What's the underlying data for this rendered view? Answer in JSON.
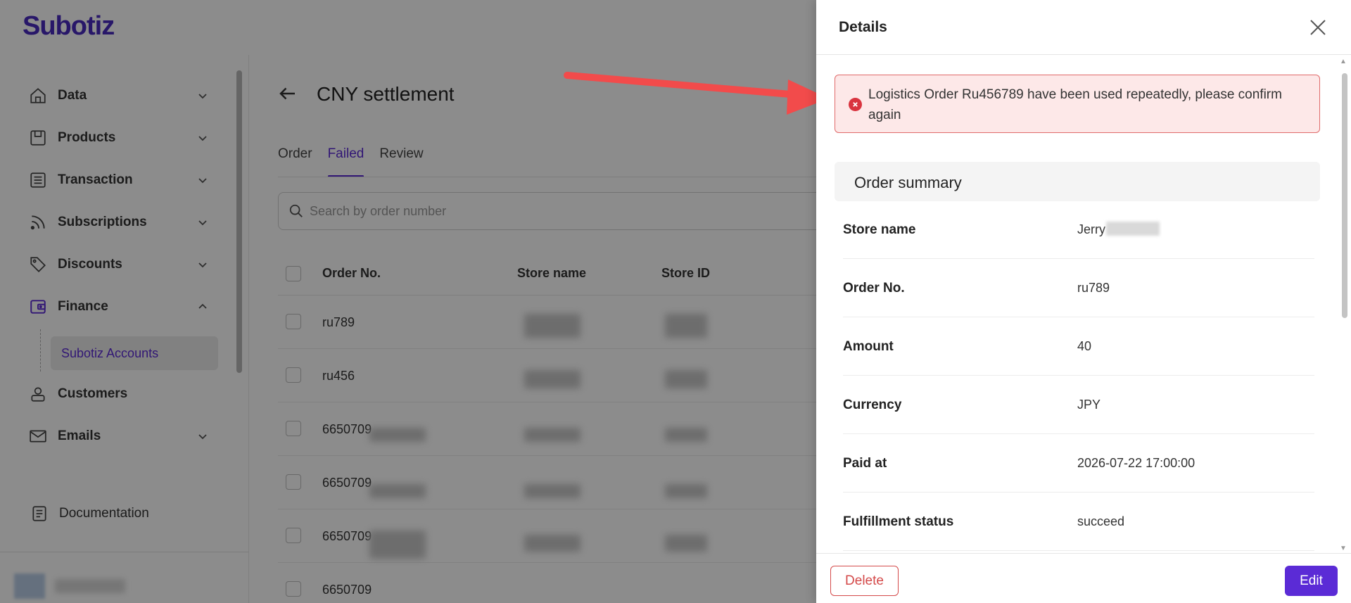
{
  "app": {
    "logo": "Subotiz",
    "accent_color": "#5b2bd6"
  },
  "sidebar": {
    "items": [
      {
        "label": "Data",
        "icon": "home-icon",
        "expandable": true
      },
      {
        "label": "Products",
        "icon": "box-icon",
        "expandable": true
      },
      {
        "label": "Transaction",
        "icon": "list-icon",
        "expandable": true
      },
      {
        "label": "Subscriptions",
        "icon": "rss-icon",
        "expandable": true
      },
      {
        "label": "Discounts",
        "icon": "tag-icon",
        "expandable": true
      },
      {
        "label": "Finance",
        "icon": "wallet-icon",
        "expandable": true,
        "expanded": true
      },
      {
        "label": "Customers",
        "icon": "user-icon",
        "expandable": false
      },
      {
        "label": "Emails",
        "icon": "mail-icon",
        "expandable": true
      }
    ],
    "sub_item": "Subotiz Accounts",
    "documentation": "Documentation"
  },
  "main": {
    "title": "CNY settlement",
    "tabs": [
      "Order",
      "Failed",
      "Review"
    ],
    "active_tab": "Failed",
    "search_placeholder": "Search by order number",
    "table": {
      "columns": [
        "Order No.",
        "Store name",
        "Store ID"
      ],
      "rows": [
        "ru789",
        "ru456",
        "6650709",
        "6650709",
        "6650709",
        "6650709"
      ]
    }
  },
  "drawer": {
    "title": "Details",
    "alert": "Logistics Order Ru456789 have been used repeatedly, please confirm again",
    "summary_title": "Order summary",
    "fields": [
      {
        "label": "Store name",
        "value": "Jerry"
      },
      {
        "label": "Order No.",
        "value": "ru789"
      },
      {
        "label": "Amount",
        "value": "40"
      },
      {
        "label": "Currency",
        "value": "JPY"
      },
      {
        "label": "Paid at",
        "value": "2026-07-22 17:00:00"
      },
      {
        "label": "Fulfillment status",
        "value": "succeed"
      }
    ],
    "delete_label": "Delete",
    "edit_label": "Edit"
  }
}
